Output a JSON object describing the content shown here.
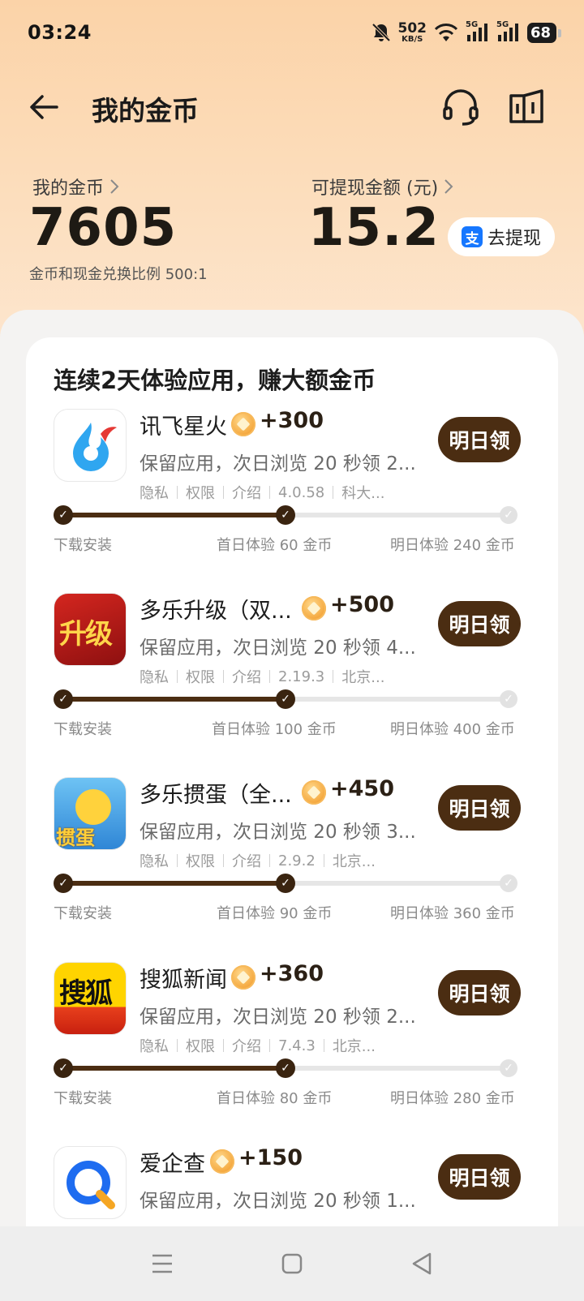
{
  "status_bar": {
    "time": "03:24",
    "net_speed_value": "502",
    "net_speed_unit": "KB/S",
    "battery": "68",
    "net_type_1": "5G",
    "net_type_2": "5G"
  },
  "header": {
    "title": "我的金币",
    "icons": [
      "back-arrow-icon",
      "headset-icon",
      "book-icon"
    ]
  },
  "balance": {
    "coins_label": "我的金币",
    "coins_value": "7605",
    "cash_label": "可提现金额 (元)",
    "cash_value": "15.2",
    "withdraw_label": "去提现",
    "alipay_glyph": "支",
    "exchange_note": "金币和现金兑换比例 500:1"
  },
  "card": {
    "title": "连续2天体验应用，赚大额金币",
    "apps": [
      {
        "name": "讯飞星火",
        "reward": "+300",
        "desc": "保留应用，次日浏览 20 秒领 2...",
        "meta": [
          "隐私",
          "权限",
          "介绍",
          "4.0.58",
          "科大..."
        ],
        "button": "明日领",
        "steps": [
          "下载安装",
          "首日体验 60 金币",
          "明日体验 240 金币"
        ],
        "completed_steps": 2,
        "total_steps": 3
      },
      {
        "name": "多乐升级（双...",
        "reward": "+500",
        "desc": "保留应用，次日浏览 20 秒领 4...",
        "meta": [
          "隐私",
          "权限",
          "介绍",
          "2.19.3",
          "北京..."
        ],
        "button": "明日领",
        "steps": [
          "下载安装",
          "首日体验 100 金币",
          "明日体验 400 金币"
        ],
        "completed_steps": 2,
        "total_steps": 3
      },
      {
        "name": "多乐掼蛋（全...",
        "reward": "+450",
        "desc": "保留应用，次日浏览 20 秒领 3...",
        "meta": [
          "隐私",
          "权限",
          "介绍",
          "2.9.2",
          "北京..."
        ],
        "button": "明日领",
        "steps": [
          "下载安装",
          "首日体验 90 金币",
          "明日体验 360 金币"
        ],
        "completed_steps": 2,
        "total_steps": 3
      },
      {
        "name": "搜狐新闻",
        "reward": "+360",
        "desc": "保留应用，次日浏览 20 秒领 2...",
        "meta": [
          "隐私",
          "权限",
          "介绍",
          "7.4.3",
          "北京..."
        ],
        "button": "明日领",
        "steps": [
          "下载安装",
          "首日体验 80 金币",
          "明日体验 280 金币"
        ],
        "completed_steps": 2,
        "total_steps": 3
      },
      {
        "name": "爱企查",
        "reward": "+150",
        "desc": "保留应用，次日浏览 20 秒领 1...",
        "button": "明日领"
      }
    ],
    "icon_texts": {
      "shengji": "升级",
      "guandan": "掼蛋",
      "sohu": "搜狐"
    }
  },
  "nav_bar": {
    "icons": [
      "menu-icon",
      "home-icon",
      "back-icon"
    ]
  },
  "colors": {
    "accent_brown": "#4b2d12",
    "header_gradient_top": "#fbd3a8",
    "coin_orange": "#f4a63c"
  }
}
